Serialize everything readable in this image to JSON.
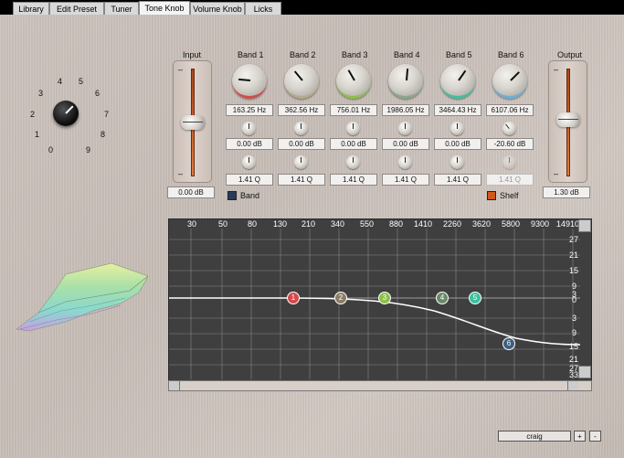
{
  "tabs": [
    "Library",
    "Edit Preset",
    "Tuner",
    "Tone Knob",
    "Volume Knob",
    "Licks"
  ],
  "active_tab": "Tone Knob",
  "tone_knob": {
    "scale": [
      "0",
      "1",
      "2",
      "3",
      "4",
      "5",
      "6",
      "7",
      "8",
      "9"
    ]
  },
  "input": {
    "label": "Input",
    "value": "0.00 dB",
    "level": 0.5
  },
  "output": {
    "label": "Output",
    "value": "1.30 dB",
    "level": 0.52
  },
  "bands": [
    {
      "name": "Band 1",
      "freq": "163.25 Hz",
      "gain": "0.00 dB",
      "q": "1.41 Q",
      "color": "#d44a4a"
    },
    {
      "name": "Band 2",
      "freq": "362.56 Hz",
      "gain": "0.00 dB",
      "q": "1.41 Q",
      "color": "#b7a88a"
    },
    {
      "name": "Band 3",
      "freq": "756.01 Hz",
      "gain": "0.00 dB",
      "q": "1.41 Q",
      "color": "#8dbf4a"
    },
    {
      "name": "Band 4",
      "freq": "1986.05 Hz",
      "gain": "0.00 dB",
      "q": "1.41 Q",
      "color": "#8aa88a"
    },
    {
      "name": "Band 5",
      "freq": "3464.43 Hz",
      "gain": "0.00 dB",
      "q": "1.41 Q",
      "color": "#3dc0a0"
    },
    {
      "name": "Band 6",
      "freq": "6107.06 Hz",
      "gain": "-20.60 dB",
      "q": "1.41 Q",
      "color": "#6ab0d8"
    }
  ],
  "band_toggle": {
    "label": "Band"
  },
  "shelf_toggle": {
    "label": "Shelf"
  },
  "eq_graph": {
    "x_ticks": [
      "30",
      "50",
      "80",
      "130",
      "210",
      "340",
      "550",
      "880",
      "1410",
      "2260",
      "3620",
      "5800",
      "9300",
      "14910"
    ],
    "y_ticks": [
      "27",
      "21",
      "15",
      "9",
      "3",
      "0",
      "3",
      "9",
      "15",
      "21",
      "27",
      "33"
    ],
    "nodes": [
      "1",
      "2",
      "3",
      "4",
      "5",
      "6"
    ]
  },
  "preset": {
    "name": "craig",
    "add": "+",
    "remove": "-"
  }
}
